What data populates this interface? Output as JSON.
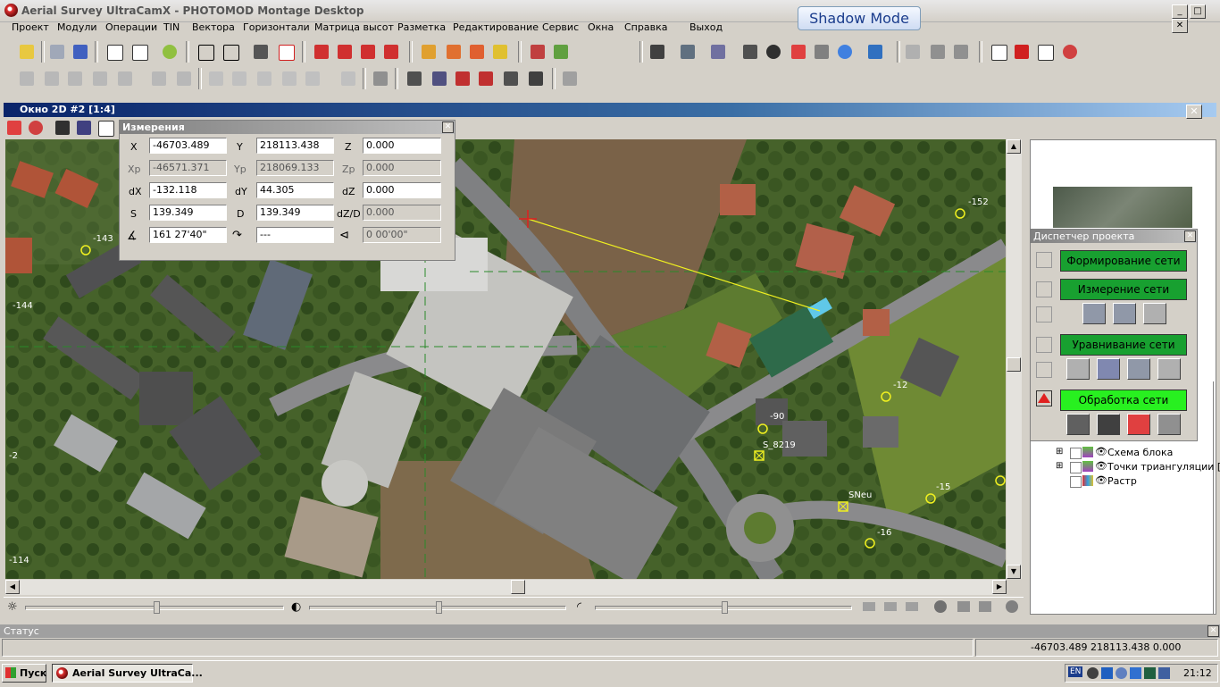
{
  "app": {
    "title": "Aerial Survey UltraCamX - PHOTOMOD Montage Desktop",
    "shadow_mode": "Shadow Mode"
  },
  "menu": [
    "Проект",
    "Модули",
    "Операции",
    "TIN",
    "Вектора",
    "Горизонтали",
    "Матрица высот",
    "Разметка",
    "Редактирование",
    "Сервис",
    "Окна",
    "Справка",
    "Выход"
  ],
  "window2d": {
    "title": "Окно 2D #2 [1:4]"
  },
  "measure": {
    "title": "Измерения",
    "x_label": "X",
    "x": "-46703.489",
    "y_label": "Y",
    "y": "218113.438",
    "z_label": "Z",
    "z": "0.000",
    "xp_label": "Xp",
    "xp": "-46571.371",
    "yp_label": "Yp",
    "yp": "218069.133",
    "zp_label": "Zp",
    "zp": "0.000",
    "dx_label": "dX",
    "dx": "-132.118",
    "dy_label": "dY",
    "dy": "44.305",
    "dz_label": "dZ",
    "dz": "0.000",
    "s_label": "S",
    "s": "139.349",
    "d_label": "D",
    "d": "139.349",
    "dzd_label": "dZ/D",
    "dzd": "0.000",
    "angle": "161 27'40\"",
    "rot": "---",
    "slope": "0 00'00\""
  },
  "map_labels": [
    "-143",
    "-144",
    "-152",
    "-12",
    "-90",
    "S_8219",
    "SNeu",
    "-15",
    "-16",
    "-114",
    "-2"
  ],
  "manager": {
    "title": "Диспетчер проекта",
    "btn1": "Формирование сети",
    "btn2": "Измерение сети",
    "btn3": "Уравнивание сети",
    "btn4": "Обработка сети"
  },
  "layers": [
    "Схема блока",
    "Точки триангуляции [R",
    "Растр"
  ],
  "status": {
    "title": "Статус",
    "coords": "-46703.489 218113.438 0.000"
  },
  "taskbar": {
    "start": "Пуск",
    "task": "Aerial Survey UltraCa...",
    "lang": "EN",
    "time": "21:12"
  }
}
